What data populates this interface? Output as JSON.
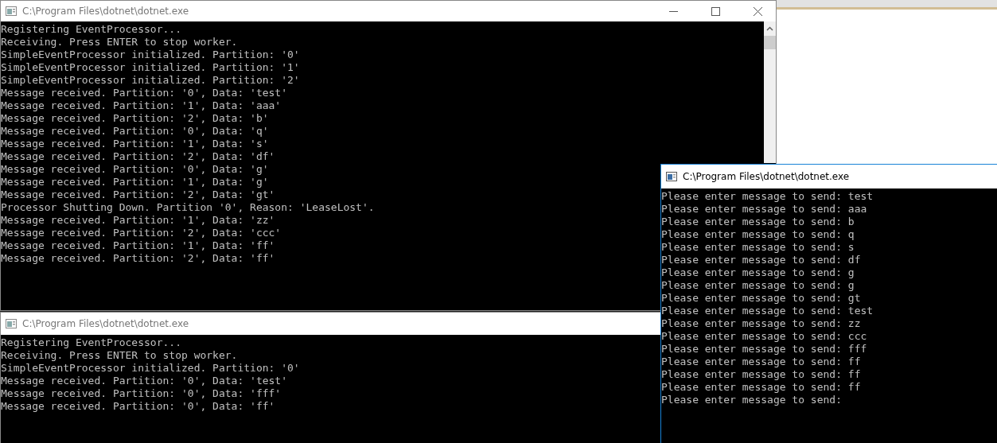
{
  "windows": [
    {
      "title": "C:\\Program Files\\dotnet\\dotnet.exe",
      "active": false,
      "controls": true,
      "scrollbar": true,
      "lines": [
        "Registering EventProcessor...",
        "Receiving. Press ENTER to stop worker.",
        "SimpleEventProcessor initialized. Partition: '0'",
        "SimpleEventProcessor initialized. Partition: '1'",
        "SimpleEventProcessor initialized. Partition: '2'",
        "Message received. Partition: '0', Data: 'test'",
        "Message received. Partition: '1', Data: 'aaa'",
        "Message received. Partition: '2', Data: 'b'",
        "Message received. Partition: '0', Data: 'q'",
        "Message received. Partition: '1', Data: 's'",
        "Message received. Partition: '2', Data: 'df'",
        "Message received. Partition: '0', Data: 'g'",
        "Message received. Partition: '1', Data: 'g'",
        "Message received. Partition: '2', Data: 'gt'",
        "Processor Shutting Down. Partition '0', Reason: 'LeaseLost'.",
        "Message received. Partition: '1', Data: 'zz'",
        "Message received. Partition: '2', Data: 'ccc'",
        "Message received. Partition: '1', Data: 'ff'",
        "Message received. Partition: '2', Data: 'ff'"
      ]
    },
    {
      "title": "C:\\Program Files\\dotnet\\dotnet.exe",
      "active": false,
      "controls": false,
      "scrollbar": false,
      "lines": [
        "Registering EventProcessor...",
        "Receiving. Press ENTER to stop worker.",
        "SimpleEventProcessor initialized. Partition: '0'",
        "Message received. Partition: '0', Data: 'test'",
        "Message received. Partition: '0', Data: 'fff'",
        "Message received. Partition: '0', Data: 'ff'"
      ]
    },
    {
      "title": "C:\\Program Files\\dotnet\\dotnet.exe",
      "active": true,
      "controls": false,
      "scrollbar": false,
      "lines": [
        "Please enter message to send: test",
        "Please enter message to send: aaa",
        "Please enter message to send: b",
        "Please enter message to send: q",
        "Please enter message to send: s",
        "Please enter message to send: df",
        "Please enter message to send: g",
        "Please enter message to send: g",
        "Please enter message to send: gt",
        "Please enter message to send: test",
        "Please enter message to send: zz",
        "Please enter message to send: ccc",
        "Please enter message to send: fff",
        "Please enter message to send: ff",
        "Please enter message to send: ff",
        "Please enter message to send: ff",
        "Please enter message to send:"
      ]
    }
  ]
}
